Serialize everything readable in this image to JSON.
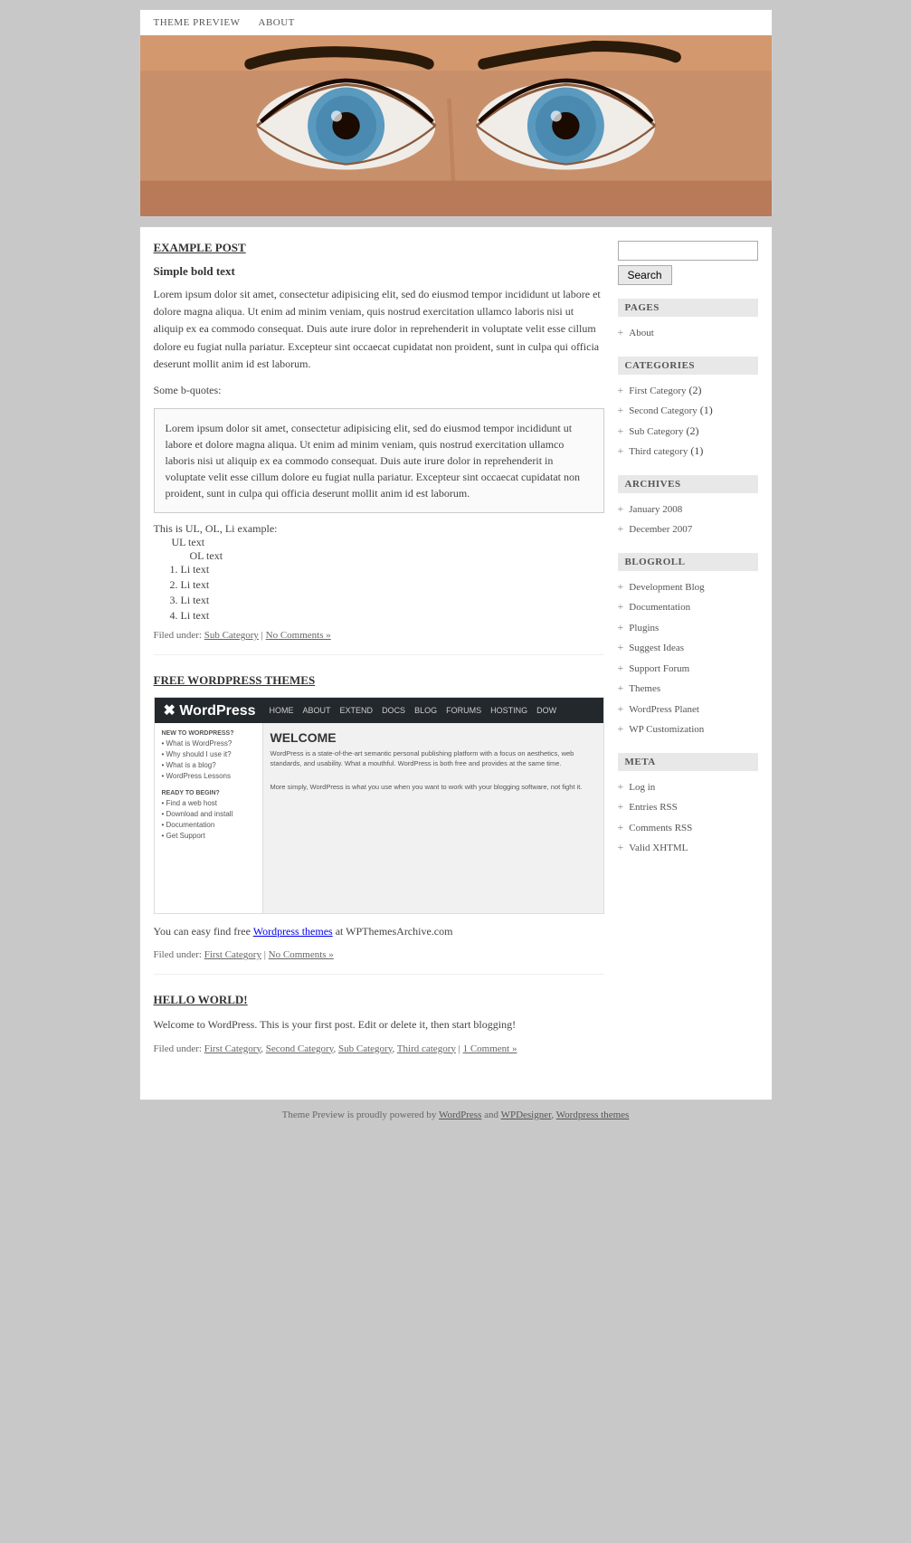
{
  "nav": {
    "items": [
      {
        "label": "THEME PREVIEW",
        "href": "#"
      },
      {
        "label": "ABOUT",
        "href": "#"
      }
    ]
  },
  "posts": [
    {
      "id": "example-post",
      "title": "EXAMPLE POST",
      "subtitle": "Simple bold text",
      "body1": "Lorem ipsum dolor sit amet, consectetur adipisicing elit, sed do eiusmod tempor incididunt ut labore et dolore magna aliqua. Ut enim ad minim veniam, quis nostrud exercitation ullamco laboris nisi ut aliquip ex ea commodo consequat. Duis aute irure dolor in reprehenderit in voluptate velit esse cillum dolore eu fugiat nulla pariatur. Excepteur sint occaecat cupidatat non proident, sunt in culpa qui officia deserunt mollit anim id est laborum.",
      "bquote_label": "Some b-quotes:",
      "blockquote": "Lorem ipsum dolor sit amet, consectetur adipisicing elit, sed do eiusmod tempor incididunt ut labore et dolore magna aliqua. Ut enim ad minim veniam, quis nostrud exercitation ullamco laboris nisi ut aliquip ex ea commodo consequat. Duis aute irure dolor in reprehenderit in voluptate velit esse cillum dolore eu fugiat nulla pariatur. Excepteur sint occaecat cupidatat non proident, sunt in culpa qui officia deserunt mollit anim id est laborum.",
      "list_label": "This is UL, OL, Li example:",
      "ul_text": "UL text",
      "ol_text": "OL text",
      "li_items": [
        "Li text",
        "Li text",
        "Li text",
        "Li text"
      ],
      "footer": "Filed under:",
      "footer_links": [
        "Sub Category",
        "No Comments »"
      ]
    },
    {
      "id": "free-wp-themes",
      "title": "FREE WORDPRESS THEMES",
      "body_text": "You can easy find free Wordpress themes at WPThemesArchive.com",
      "footer": "Filed under:",
      "footer_links": [
        "First Category",
        "No Comments »"
      ]
    },
    {
      "id": "hello-world",
      "title": "HELLO WORLD!",
      "body_text": "Welcome to WordPress. This is your first post. Edit or delete it, then start blogging!",
      "footer": "Filed under:",
      "footer_links": [
        "First Category",
        "Second Category",
        "Sub Category",
        "Third category"
      ],
      "comment_link": "1 Comment »"
    }
  ],
  "sidebar": {
    "search_placeholder": "",
    "search_button": "Search",
    "pages_title": "PAGES",
    "pages": [
      {
        "label": "About"
      }
    ],
    "categories_title": "CATEGORIES",
    "categories": [
      {
        "label": "First Category",
        "count": "(2)"
      },
      {
        "label": "Second Category",
        "count": "(1)"
      },
      {
        "label": "Sub Category",
        "count": "(2)"
      },
      {
        "label": "Third category",
        "count": "(1)"
      }
    ],
    "archives_title": "ARCHIVES",
    "archives": [
      {
        "label": "January 2008"
      },
      {
        "label": "December 2007"
      }
    ],
    "blogroll_title": "BLOGROLL",
    "blogroll": [
      {
        "label": "Development Blog"
      },
      {
        "label": "Documentation"
      },
      {
        "label": "Plugins"
      },
      {
        "label": "Suggest Ideas"
      },
      {
        "label": "Support Forum"
      },
      {
        "label": "Themes"
      },
      {
        "label": "WordPress Planet"
      },
      {
        "label": "WP Customization"
      }
    ],
    "meta_title": "META",
    "meta": [
      {
        "label": "Log in"
      },
      {
        "label": "Entries RSS"
      },
      {
        "label": "Comments RSS"
      },
      {
        "label": "Valid XHTML"
      }
    ]
  },
  "footer": {
    "text": "Theme Preview is proudly powered by ",
    "links": [
      {
        "label": "WordPress",
        "href": "#"
      },
      {
        "label": "WPDesigner",
        "href": "#"
      },
      {
        "label": "Wordpress themes",
        "href": "#"
      }
    ]
  },
  "wordpress_screenshot": {
    "nav_items": [
      "HOME",
      "ABOUT",
      "EXTEND",
      "DOCS",
      "BLOG",
      "FORUMS",
      "HOSTING",
      "DOW"
    ],
    "welcome_text": "WELCOME",
    "body_text": "WordPress is a state-of-the-art semantic personal publishing platform with a focus on aesthetics, web standards, and usability. What a mouthful. WordPress is both free and provides at the same time.",
    "body_text2": "More simply, WordPress is what you use when you want to work with your blogging software, not fight it.",
    "left_items": [
      "NEW TO WORDPRESS?",
      "• What is WordPress?",
      "• Why should I use it?",
      "• What is a blog?",
      "• WordPress Lessons"
    ],
    "ready_text": "READY TO BEGIN?",
    "ready_items": [
      "• Find a web host",
      "• Download and install",
      "• Documentation",
      "• Get Support"
    ]
  }
}
